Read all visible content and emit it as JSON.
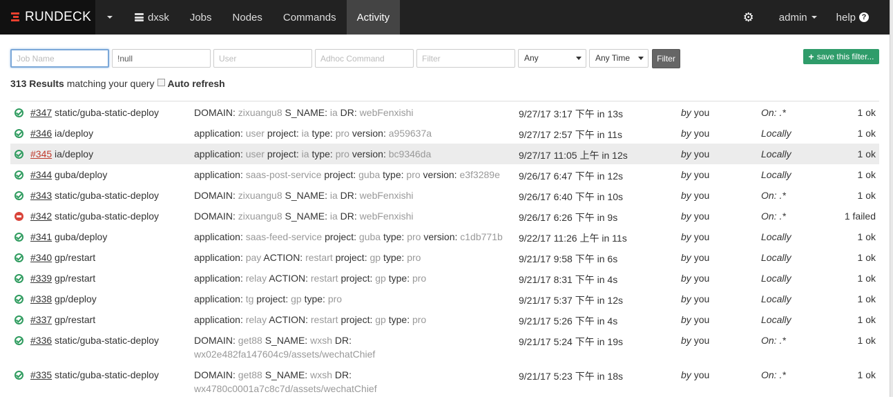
{
  "navbar": {
    "brand": "RUNDECK",
    "project": "dxsk",
    "items": [
      "Jobs",
      "Nodes",
      "Commands",
      "Activity"
    ],
    "user": "admin",
    "help": "help"
  },
  "filters": {
    "job_name_placeholder": "Job Name",
    "exclude_value": "!null",
    "user_placeholder": "User",
    "adhoc_placeholder": "Adhoc Command",
    "filter_placeholder": "Filter",
    "status_select": "Any",
    "time_select": "Any Time",
    "filter_button": "Filter",
    "save_button": "save this filter..."
  },
  "summary": {
    "count": "313 Results",
    "text": "matching your query",
    "auto_refresh": "Auto refresh"
  },
  "rows": [
    {
      "status": "ok",
      "num": "#347",
      "job": "static/guba-static-deploy",
      "args": [
        [
          "DOMAIN:",
          "zixuangu8"
        ],
        [
          "S_NAME:",
          "ia"
        ],
        [
          "DR:",
          "webFenxishi"
        ]
      ],
      "date": "9/27/17 3:17 下午 in 13s",
      "by": "by",
      "user": "you",
      "node": "On: .*",
      "count": "1 ok"
    },
    {
      "status": "ok",
      "num": "#346",
      "job": "ia/deploy",
      "args": [
        [
          "application:",
          "user"
        ],
        [
          "project:",
          "ia"
        ],
        [
          "type:",
          "pro"
        ],
        [
          "version:",
          "a959637a"
        ]
      ],
      "date": "9/27/17 2:57 下午 in 11s",
      "by": "by",
      "user": "you",
      "node": "Locally",
      "count": "1 ok"
    },
    {
      "status": "ok",
      "num": "#345",
      "job": "ia/deploy",
      "args": [
        [
          "application:",
          "user"
        ],
        [
          "project:",
          "ia"
        ],
        [
          "type:",
          "pro"
        ],
        [
          "version:",
          "bc9346da"
        ]
      ],
      "date": "9/27/17 11:05 上午 in 12s",
      "by": "by",
      "user": "you",
      "node": "Locally",
      "count": "1 ok",
      "highlight": true
    },
    {
      "status": "ok",
      "num": "#344",
      "job": "guba/deploy",
      "args": [
        [
          "application:",
          "saas-post-service"
        ],
        [
          "project:",
          "guba"
        ],
        [
          "type:",
          "pro"
        ],
        [
          "version:",
          "e3f3289e"
        ]
      ],
      "date": "9/26/17 6:47 下午 in 12s",
      "by": "by",
      "user": "you",
      "node": "Locally",
      "count": "1 ok"
    },
    {
      "status": "ok",
      "num": "#343",
      "job": "static/guba-static-deploy",
      "args": [
        [
          "DOMAIN:",
          "zixuangu8"
        ],
        [
          "S_NAME:",
          "ia"
        ],
        [
          "DR:",
          "webFenxishi"
        ]
      ],
      "date": "9/26/17 6:40 下午 in 10s",
      "by": "by",
      "user": "you",
      "node": "On: .*",
      "count": "1 ok"
    },
    {
      "status": "fail",
      "num": "#342",
      "job": "static/guba-static-deploy",
      "args": [
        [
          "DOMAIN:",
          "zixuangu8"
        ],
        [
          "S_NAME:",
          "ia"
        ],
        [
          "DR:",
          "webFenxishi"
        ]
      ],
      "date": "9/26/17 6:26 下午 in 9s",
      "by": "by",
      "user": "you",
      "node": "On: .*",
      "count": "1 failed"
    },
    {
      "status": "ok",
      "num": "#341",
      "job": "guba/deploy",
      "args": [
        [
          "application:",
          "saas-feed-service"
        ],
        [
          "project:",
          "guba"
        ],
        [
          "type:",
          "pro"
        ],
        [
          "version:",
          "c1db771b"
        ]
      ],
      "date": "9/22/17 11:26 上午 in 11s",
      "by": "by",
      "user": "you",
      "node": "Locally",
      "count": "1 ok"
    },
    {
      "status": "ok",
      "num": "#340",
      "job": "gp/restart",
      "args": [
        [
          "application:",
          "pay"
        ],
        [
          "ACTION:",
          "restart"
        ],
        [
          "project:",
          "gp"
        ],
        [
          "type:",
          "pro"
        ]
      ],
      "date": "9/21/17 9:58 下午 in 6s",
      "by": "by",
      "user": "you",
      "node": "Locally",
      "count": "1 ok"
    },
    {
      "status": "ok",
      "num": "#339",
      "job": "gp/restart",
      "args": [
        [
          "application:",
          "relay"
        ],
        [
          "ACTION:",
          "restart"
        ],
        [
          "project:",
          "gp"
        ],
        [
          "type:",
          "pro"
        ]
      ],
      "date": "9/21/17 8:31 下午 in 4s",
      "by": "by",
      "user": "you",
      "node": "Locally",
      "count": "1 ok"
    },
    {
      "status": "ok",
      "num": "#338",
      "job": "gp/deploy",
      "args": [
        [
          "application:",
          "tg"
        ],
        [
          "project:",
          "gp"
        ],
        [
          "type:",
          "pro"
        ]
      ],
      "date": "9/21/17 5:37 下午 in 12s",
      "by": "by",
      "user": "you",
      "node": "Locally",
      "count": "1 ok"
    },
    {
      "status": "ok",
      "num": "#337",
      "job": "gp/restart",
      "args": [
        [
          "application:",
          "relay"
        ],
        [
          "ACTION:",
          "restart"
        ],
        [
          "project:",
          "gp"
        ],
        [
          "type:",
          "pro"
        ]
      ],
      "date": "9/21/17 5:26 下午 in 4s",
      "by": "by",
      "user": "you",
      "node": "Locally",
      "count": "1 ok"
    },
    {
      "status": "ok",
      "num": "#336",
      "job": "static/guba-static-deploy",
      "args": [
        [
          "DOMAIN:",
          "get88"
        ],
        [
          "S_NAME:",
          "wxsh"
        ],
        [
          "DR:",
          ""
        ]
      ],
      "args_wrap": "wx02e482fa147604c9/assets/wechatChief",
      "date": "9/21/17 5:24 下午 in 19s",
      "by": "by",
      "user": "you",
      "node": "On: .*",
      "count": "1 ok"
    },
    {
      "status": "ok",
      "num": "#335",
      "job": "static/guba-static-deploy",
      "args": [
        [
          "DOMAIN:",
          "get88"
        ],
        [
          "S_NAME:",
          "wxsh"
        ],
        [
          "DR:",
          ""
        ]
      ],
      "args_wrap": "wx4780c0001a7c8c7d/assets/wechatChief",
      "date": "9/21/17 5:23 下午 in 18s",
      "by": "by",
      "user": "you",
      "node": "On: .*",
      "count": "1 ok"
    }
  ],
  "colors": {
    "navbar": "#222222",
    "brand_accent": "#e8402e",
    "ok": "#2e9b5e",
    "fail": "#d9443a",
    "save_button": "#2f9c6a"
  }
}
